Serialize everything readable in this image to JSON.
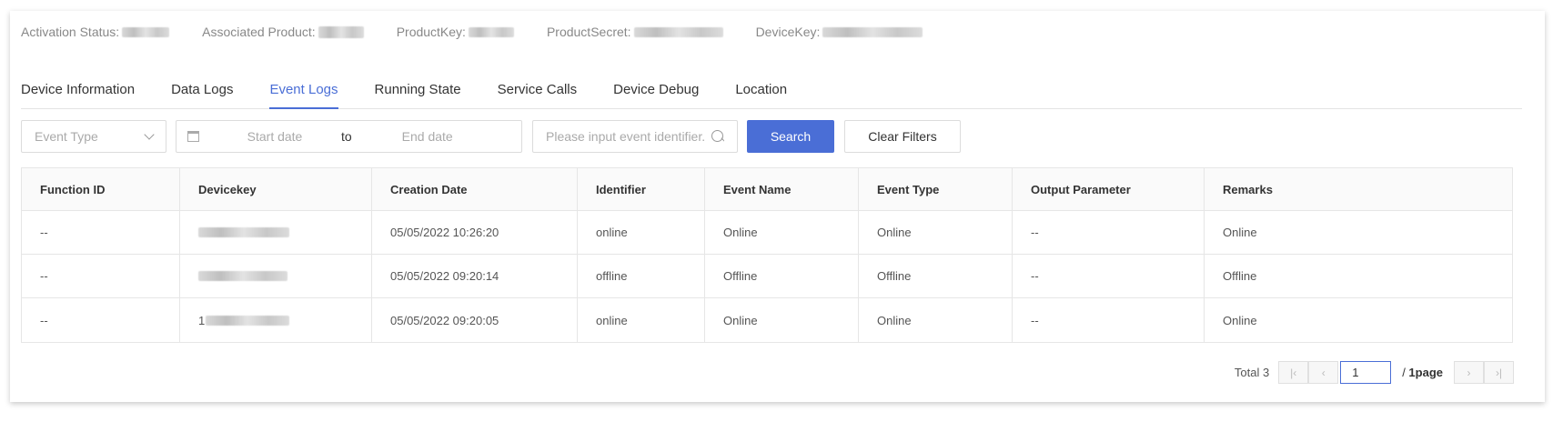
{
  "info": {
    "activation_label": "Activation Status:",
    "product_label": "Associated Product:",
    "productkey_label": "ProductKey:",
    "productsecret_label": "ProductSecret:",
    "devicekey_label": "DeviceKey:"
  },
  "tabs": [
    {
      "label": "Device Information"
    },
    {
      "label": "Data Logs"
    },
    {
      "label": "Event Logs"
    },
    {
      "label": "Running State"
    },
    {
      "label": "Service Calls"
    },
    {
      "label": "Device Debug"
    },
    {
      "label": "Location"
    }
  ],
  "filters": {
    "event_type_placeholder": "Event Type",
    "start_placeholder": "Start date",
    "to_label": "to",
    "end_placeholder": "End date",
    "identifier_placeholder": "Please input event identifier.",
    "search_label": "Search",
    "clear_label": "Clear Filters"
  },
  "table": {
    "headers": [
      "Function ID",
      "Devicekey",
      "Creation Date",
      "Identifier",
      "Event Name",
      "Event Type",
      "Output Parameter",
      "Remarks"
    ],
    "rows": [
      {
        "function_id": "--",
        "devicekey_prefix": "",
        "creation_date": "05/05/2022 10:26:20",
        "identifier": "online",
        "event_name": "Online",
        "event_type": "Online",
        "output": "--",
        "remarks": "Online"
      },
      {
        "function_id": "--",
        "devicekey_prefix": "",
        "creation_date": "05/05/2022 09:20:14",
        "identifier": "offline",
        "event_name": "Offline",
        "event_type": "Offline",
        "output": "--",
        "remarks": "Offline"
      },
      {
        "function_id": "--",
        "devicekey_prefix": "1",
        "creation_date": "05/05/2022 09:20:05",
        "identifier": "online",
        "event_name": "Online",
        "event_type": "Online",
        "output": "--",
        "remarks": "Online"
      }
    ]
  },
  "pagination": {
    "total": "Total 3",
    "current": "1",
    "pages_prefix": "/ ",
    "pages": "1page"
  },
  "colors": {
    "accent": "#4a6ed6"
  }
}
